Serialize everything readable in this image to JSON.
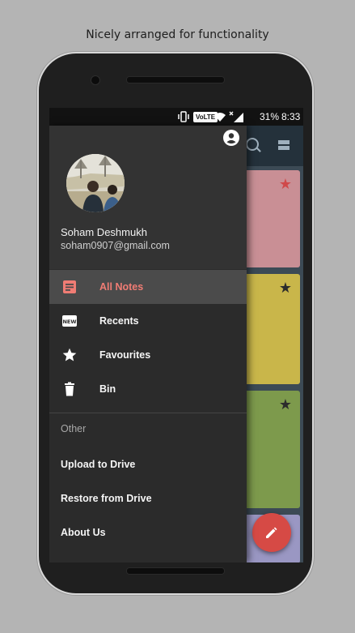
{
  "caption": "Nicely arranged for functionality",
  "status_bar": {
    "volte": "VoLTE",
    "battery": "31%",
    "time": "8:33"
  },
  "drawer": {
    "user": {
      "name": "Soham Deshmukh",
      "email": "soham0907@gmail.com"
    },
    "menu_items": [
      {
        "label": "All Notes",
        "icon": "note-icon",
        "active": true
      },
      {
        "label": "Recents",
        "icon": "new-icon",
        "active": false
      },
      {
        "label": "Favourites",
        "icon": "star-icon",
        "active": false
      },
      {
        "label": "Bin",
        "icon": "trash-icon",
        "active": false
      }
    ],
    "section_header": "Other",
    "other_items": [
      {
        "label": "Upload to Drive"
      },
      {
        "label": "Restore from Drive"
      },
      {
        "label": "About Us"
      }
    ]
  },
  "colors": {
    "accent": "#f07c74",
    "fab": "#d64a45",
    "toolbar": "#24313b",
    "note_pink": "#c98f95",
    "note_yellow": "#c9b64a",
    "note_green": "#7d9a4c",
    "note_lavender": "#9a97c3"
  }
}
